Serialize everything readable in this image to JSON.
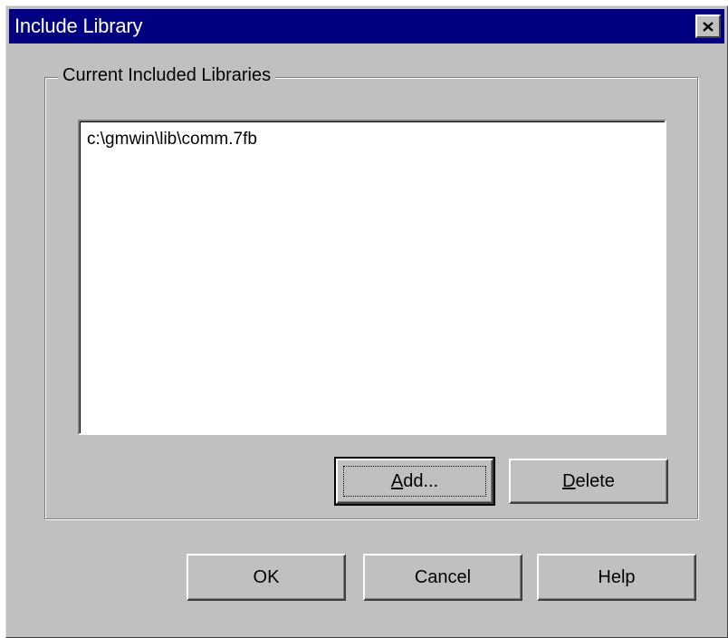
{
  "window": {
    "title": "Include Library",
    "close_icon": "close-icon"
  },
  "group": {
    "label": "Current Included Libraries"
  },
  "libraries": {
    "items": [
      "c:\\gmwin\\lib\\comm.7fb"
    ]
  },
  "buttons": {
    "add": {
      "mnemonic": "A",
      "rest": "dd..."
    },
    "delete": {
      "mnemonic": "D",
      "rest": "elete"
    },
    "ok": "OK",
    "cancel": "Cancel",
    "help": "Help"
  },
  "colors": {
    "titlebar": "#000080",
    "face": "#c0c0c0"
  }
}
